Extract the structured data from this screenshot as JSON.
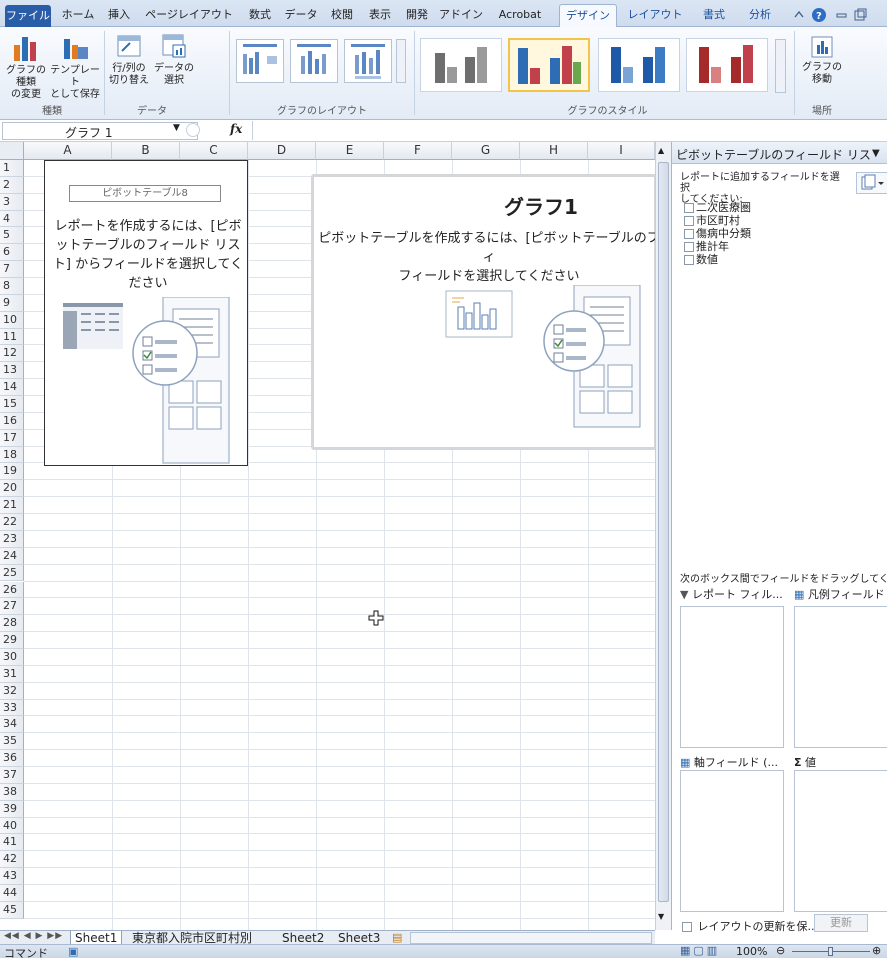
{
  "tabs": [
    "ファイル",
    "ホーム",
    "挿入",
    "ページレイアウト",
    "数式",
    "データ",
    "校閲",
    "表示",
    "開発",
    "アドイン",
    "Acrobat",
    "デザイン",
    "レイアウト",
    "書式",
    "分析"
  ],
  "ribbon": {
    "change_type": "グラフの種類\nの変更",
    "save_template": "テンプレート\nとして保存",
    "switch_rowcol": "行/列の\n切り替え",
    "select_data": "データの\n選択",
    "move_chart": "グラフの\n移動",
    "groups": {
      "type": "種類",
      "data": "データ",
      "layouts": "グラフのレイアウト",
      "styles": "グラフのスタイル",
      "location": "場所"
    }
  },
  "formula": {
    "namebox": "グラフ 1",
    "fx": "fx",
    "value": ""
  },
  "columns": [
    "A",
    "B",
    "C",
    "D",
    "E",
    "F",
    "G",
    "H",
    "I"
  ],
  "rows": [
    "1",
    "2",
    "3",
    "4",
    "5",
    "6",
    "7",
    "8",
    "9",
    "10",
    "11",
    "12",
    "13",
    "14",
    "15",
    "16",
    "17",
    "18",
    "19",
    "20",
    "21",
    "22",
    "23",
    "24",
    "25",
    "26",
    "27",
    "28",
    "29",
    "30",
    "31",
    "32",
    "33",
    "34",
    "35",
    "36",
    "37",
    "38",
    "39",
    "40",
    "41",
    "42",
    "43",
    "44",
    "45"
  ],
  "pivot": {
    "name": "ピボットテーブル8",
    "instruction": "レポートを作成するには、[ピボットテーブルのフィールド リスト] からフィールドを選択してください"
  },
  "chart": {
    "title": "グラフ1",
    "instruction": "ピボットテーブルを作成するには、[ピボットテーブルのフィ\nフィールドを選択してください"
  },
  "panel": {
    "title": "ピボットテーブルのフィールド リス",
    "choose_label": "レポートに追加するフィールドを選択\nしてください:",
    "fields": [
      "二次医療圏",
      "市区町村",
      "傷病中分類",
      "推計年",
      "数値"
    ],
    "drag_label": "次のボックス間でフィールドをドラッグしてください:",
    "report_filter": "レポート フィル...",
    "legend_field": "凡例フィールド",
    "axis_field": "軸フィールド (...",
    "values": "値",
    "defer_label": "レイアウトの更新を保...",
    "update_button": "更新"
  },
  "sheet_tabs": [
    "Sheet1",
    "東京都入院市区町村別",
    "Sheet2",
    "Sheet3"
  ],
  "status": {
    "mode": "コマンド",
    "zoom": "100%"
  },
  "colors": {
    "accent": "#2a5da8",
    "highlight": "#f2c54a",
    "bar_gray": "#7f7f7f",
    "bar_blue": "#2e6db4",
    "bar_red": "#c0404b"
  }
}
